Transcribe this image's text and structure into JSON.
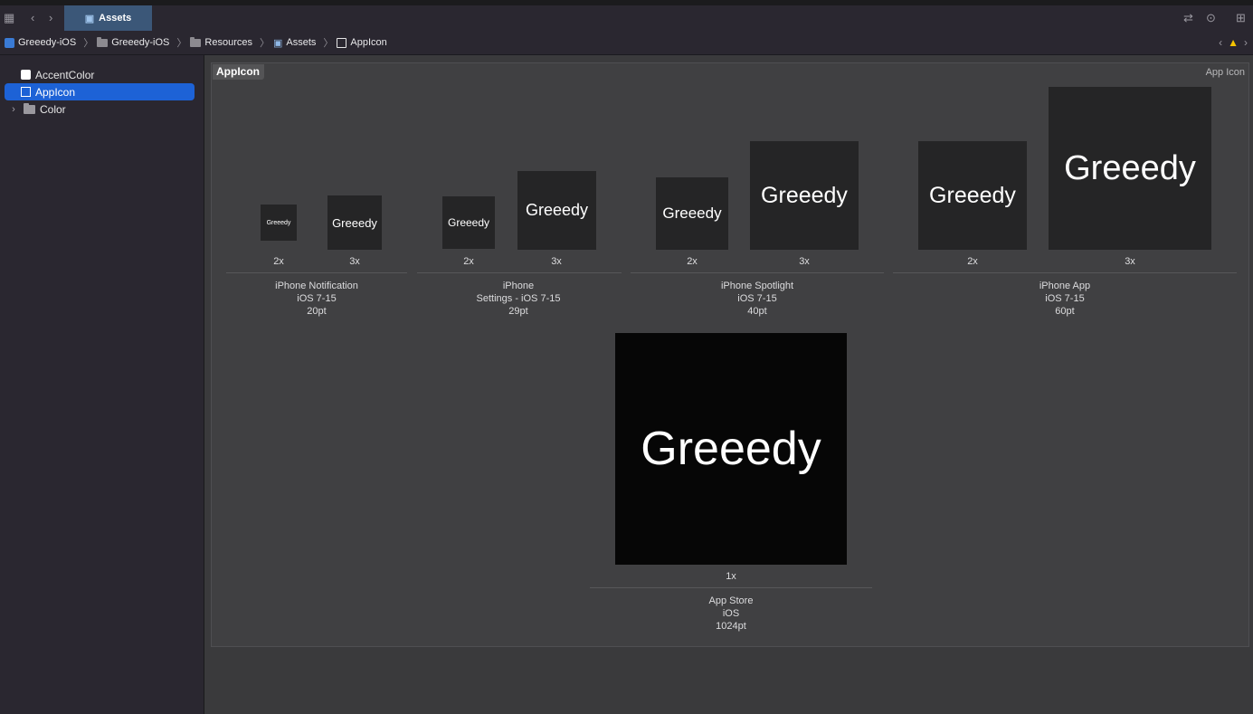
{
  "tabbar": {
    "active_tab": "Assets"
  },
  "breadcrumb": {
    "items": [
      "Greeedy-iOS",
      "Greeedy-iOS",
      "Resources",
      "Assets",
      "AppIcon"
    ]
  },
  "sidebar": {
    "items": [
      {
        "label": "AccentColor"
      },
      {
        "label": "AppIcon"
      },
      {
        "label": "Color"
      }
    ]
  },
  "panel": {
    "title": "AppIcon",
    "type_label": "App Icon",
    "icon_text": "Greeedy",
    "groups": [
      {
        "line1": "iPhone Notification",
        "line2": "iOS 7-15",
        "line3": "20pt",
        "scales": [
          "2x",
          "3x"
        ]
      },
      {
        "line1": "iPhone",
        "line2": "Settings - iOS 7-15",
        "line3": "29pt",
        "scales": [
          "2x",
          "3x"
        ]
      },
      {
        "line1": "iPhone Spotlight",
        "line2": "iOS 7-15",
        "line3": "40pt",
        "scales": [
          "2x",
          "3x"
        ]
      },
      {
        "line1": "iPhone App",
        "line2": "iOS 7-15",
        "line3": "60pt",
        "scales": [
          "2x",
          "3x"
        ]
      },
      {
        "line1": "App Store",
        "line2": "iOS",
        "line3": "1024pt",
        "scales": [
          "1x"
        ]
      }
    ]
  },
  "colors": {
    "accent": "#1d62d6",
    "warning": "#f5c400"
  }
}
